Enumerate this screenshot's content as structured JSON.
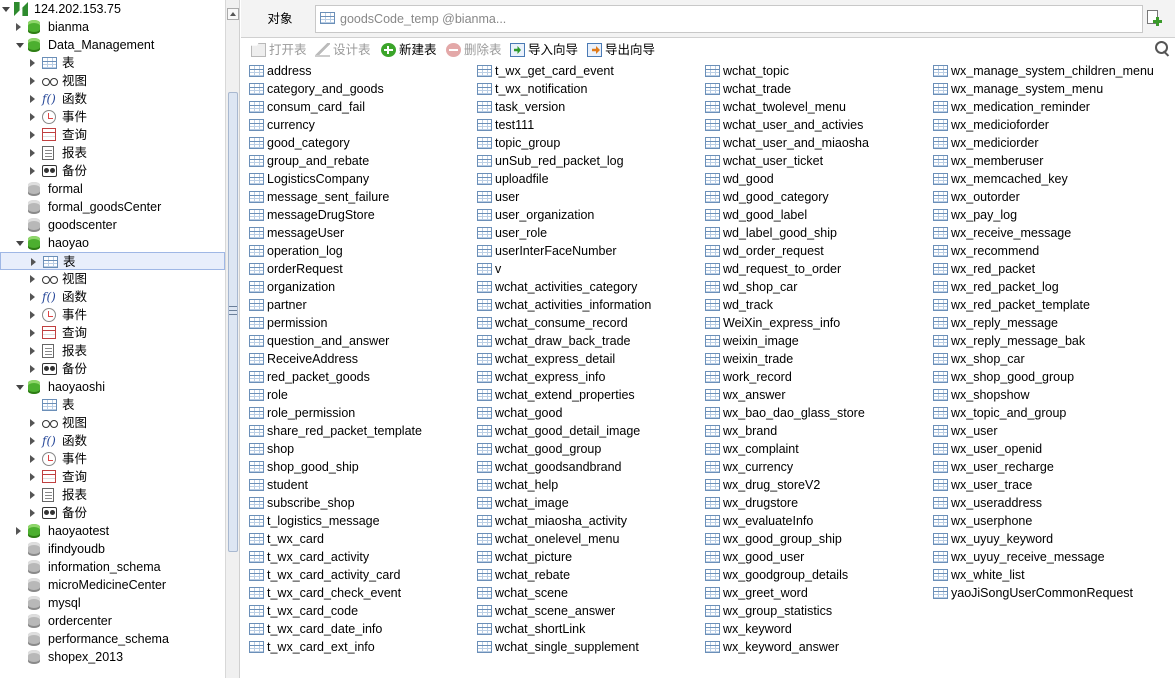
{
  "sidebar": {
    "tree": [
      {
        "label": "124.202.153.75",
        "kind": "connection",
        "level": 0,
        "twisty": "expanded"
      },
      {
        "label": "bianma",
        "kind": "db",
        "level": 1,
        "twisty": "collapsed"
      },
      {
        "label": "Data_Management",
        "kind": "db",
        "level": 1,
        "twisty": "expanded"
      },
      {
        "label": "表",
        "kind": "table",
        "level": 2,
        "twisty": "collapsed"
      },
      {
        "label": "视图",
        "kind": "view",
        "level": 2,
        "twisty": "collapsed"
      },
      {
        "label": "函数",
        "kind": "func",
        "level": 2,
        "twisty": "collapsed"
      },
      {
        "label": "事件",
        "kind": "event",
        "level": 2,
        "twisty": "collapsed"
      },
      {
        "label": "查询",
        "kind": "query",
        "level": 2,
        "twisty": "collapsed"
      },
      {
        "label": "报表",
        "kind": "report",
        "level": 2,
        "twisty": "collapsed"
      },
      {
        "label": "备份",
        "kind": "backup",
        "level": 2,
        "twisty": "collapsed"
      },
      {
        "label": "formal",
        "kind": "db-grey",
        "level": 1,
        "twisty": "none"
      },
      {
        "label": "formal_goodsCenter",
        "kind": "db-grey",
        "level": 1,
        "twisty": "none"
      },
      {
        "label": "goodscenter",
        "kind": "db-grey",
        "level": 1,
        "twisty": "none"
      },
      {
        "label": "haoyao",
        "kind": "db",
        "level": 1,
        "twisty": "expanded"
      },
      {
        "label": "表",
        "kind": "table",
        "level": 2,
        "twisty": "collapsed",
        "selected": true
      },
      {
        "label": "视图",
        "kind": "view",
        "level": 2,
        "twisty": "collapsed"
      },
      {
        "label": "函数",
        "kind": "func",
        "level": 2,
        "twisty": "collapsed"
      },
      {
        "label": "事件",
        "kind": "event",
        "level": 2,
        "twisty": "collapsed"
      },
      {
        "label": "查询",
        "kind": "query",
        "level": 2,
        "twisty": "collapsed"
      },
      {
        "label": "报表",
        "kind": "report",
        "level": 2,
        "twisty": "collapsed"
      },
      {
        "label": "备份",
        "kind": "backup",
        "level": 2,
        "twisty": "collapsed"
      },
      {
        "label": "haoyaoshi",
        "kind": "db",
        "level": 1,
        "twisty": "expanded"
      },
      {
        "label": "表",
        "kind": "table",
        "level": 2,
        "twisty": "none"
      },
      {
        "label": "视图",
        "kind": "view",
        "level": 2,
        "twisty": "collapsed"
      },
      {
        "label": "函数",
        "kind": "func",
        "level": 2,
        "twisty": "collapsed"
      },
      {
        "label": "事件",
        "kind": "event",
        "level": 2,
        "twisty": "collapsed"
      },
      {
        "label": "查询",
        "kind": "query",
        "level": 2,
        "twisty": "collapsed"
      },
      {
        "label": "报表",
        "kind": "report",
        "level": 2,
        "twisty": "collapsed"
      },
      {
        "label": "备份",
        "kind": "backup",
        "level": 2,
        "twisty": "collapsed"
      },
      {
        "label": "haoyaotest",
        "kind": "db",
        "level": 1,
        "twisty": "collapsed"
      },
      {
        "label": "ifindyoudb",
        "kind": "db-grey",
        "level": 1,
        "twisty": "none"
      },
      {
        "label": "information_schema",
        "kind": "db-grey",
        "level": 1,
        "twisty": "none"
      },
      {
        "label": "microMedicineCenter",
        "kind": "db-grey",
        "level": 1,
        "twisty": "none"
      },
      {
        "label": "mysql",
        "kind": "db-grey",
        "level": 1,
        "twisty": "none"
      },
      {
        "label": "ordercenter",
        "kind": "db-grey",
        "level": 1,
        "twisty": "none"
      },
      {
        "label": "performance_schema",
        "kind": "db-grey",
        "level": 1,
        "twisty": "none"
      },
      {
        "label": "shopex_2013",
        "kind": "db-grey",
        "level": 1,
        "twisty": "none"
      }
    ]
  },
  "tabs": {
    "objects_label": "对象",
    "query_title": "goodsCode_temp @bianma..."
  },
  "toolbar": {
    "open_table": "打开表",
    "design_table": "设计表",
    "new_table": "新建表",
    "delete_table": "删除表",
    "import_wizard": "导入向导",
    "export_wizard": "导出向导"
  },
  "tables": [
    [
      "address",
      "category_and_goods",
      "consum_card_fail",
      "currency",
      "good_category",
      "group_and_rebate",
      "LogisticsCompany",
      "message_sent_failure",
      "messageDrugStore",
      "messageUser",
      "operation_log",
      "orderRequest",
      "organization",
      "partner",
      "permission",
      "question_and_answer",
      "ReceiveAddress",
      "red_packet_goods",
      "role",
      "role_permission",
      "share_red_packet_template",
      "shop",
      "shop_good_ship",
      "student",
      "subscribe_shop",
      "t_logistics_message",
      "t_wx_card",
      "t_wx_card_activity",
      "t_wx_card_activity_card",
      "t_wx_card_check_event",
      "t_wx_card_code",
      "t_wx_card_date_info",
      "t_wx_card_ext_info"
    ],
    [
      "t_wx_get_card_event",
      "t_wx_notification",
      "task_version",
      "test111",
      "topic_group",
      "unSub_red_packet_log",
      "uploadfile",
      "user",
      "user_organization",
      "user_role",
      "userInterFaceNumber",
      "v",
      "wchat_activities_category",
      "wchat_activities_information",
      "wchat_consume_record",
      "wchat_draw_back_trade",
      "wchat_express_detail",
      "wchat_express_info",
      "wchat_extend_properties",
      "wchat_good",
      "wchat_good_detail_image",
      "wchat_good_group",
      "wchat_goodsandbrand",
      "wchat_help",
      "wchat_image",
      "wchat_miaosha_activity",
      "wchat_onelevel_menu",
      "wchat_picture",
      "wchat_rebate",
      "wchat_scene",
      "wchat_scene_answer",
      "wchat_shortLink",
      "wchat_single_supplement"
    ],
    [
      "wchat_topic",
      "wchat_trade",
      "wchat_twolevel_menu",
      "wchat_user_and_activies",
      "wchat_user_and_miaosha",
      "wchat_user_ticket",
      "wd_good",
      "wd_good_category",
      "wd_good_label",
      "wd_label_good_ship",
      "wd_order_request",
      "wd_request_to_order",
      "wd_shop_car",
      "wd_track",
      "WeiXin_express_info",
      "weixin_image",
      "weixin_trade",
      "work_record",
      "wx_answer",
      "wx_bao_dao_glass_store",
      "wx_brand",
      "wx_complaint",
      "wx_currency",
      "wx_drug_storeV2",
      "wx_drugstore",
      "wx_evaluateInfo",
      "wx_good_group_ship",
      "wx_good_user",
      "wx_goodgroup_details",
      "wx_greet_word",
      "wx_group_statistics",
      "wx_keyword",
      "wx_keyword_answer"
    ],
    [
      "wx_manage_system_children_menu",
      "wx_manage_system_menu",
      "wx_medication_reminder",
      "wx_medicioforder",
      "wx_mediciorder",
      "wx_memberuser",
      "wx_memcached_key",
      "wx_outorder",
      "wx_pay_log",
      "wx_receive_message",
      "wx_recommend",
      "wx_red_packet",
      "wx_red_packet_log",
      "wx_red_packet_template",
      "wx_reply_message",
      "wx_reply_message_bak",
      "wx_shop_car",
      "wx_shop_good_group",
      "wx_shopshow",
      "wx_topic_and_group",
      "wx_user",
      "wx_user_openid",
      "wx_user_recharge",
      "wx_user_trace",
      "wx_useraddress",
      "wx_userphone",
      "wx_uyuy_keyword",
      "wx_uyuy_receive_message",
      "wx_white_list",
      "yaoJiSongUserCommonRequest"
    ]
  ]
}
